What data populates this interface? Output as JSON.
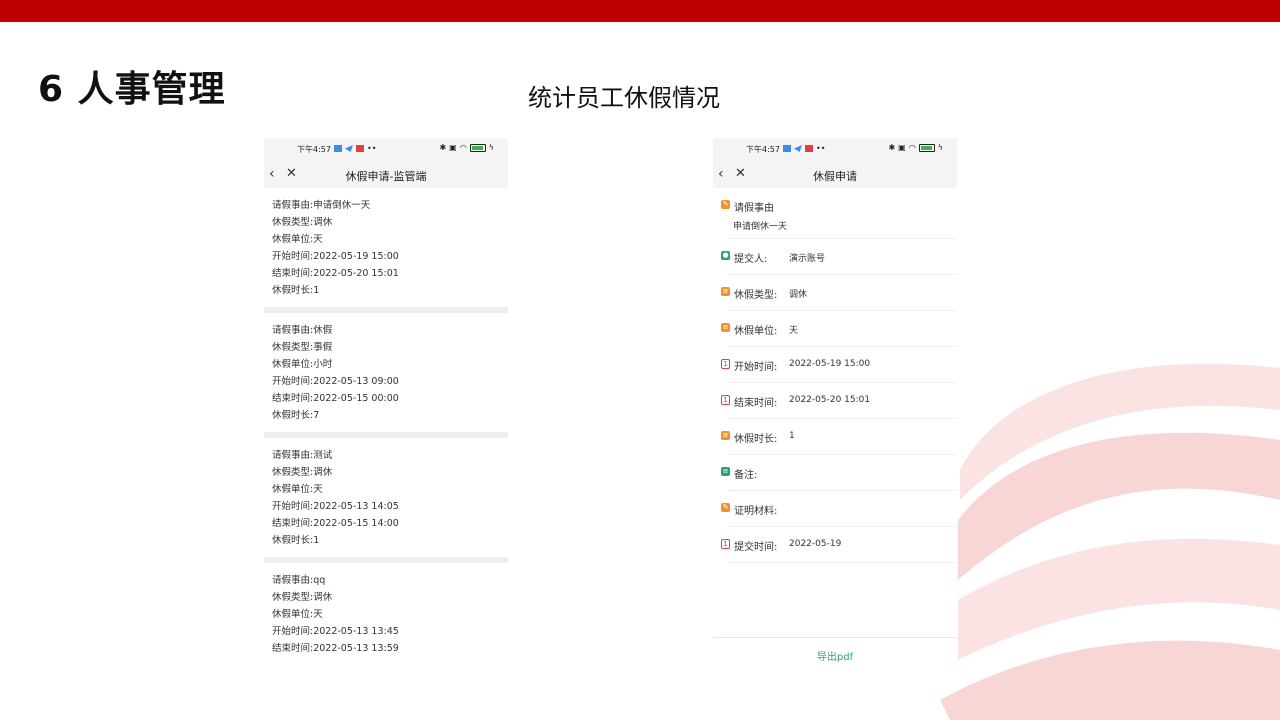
{
  "slide": {
    "title": "6 人事管理",
    "subtitle": "统计员工休假情况",
    "accent_color": "#c00000"
  },
  "status_bar": {
    "time": "下午4:57",
    "battery": "100"
  },
  "left_phone": {
    "nav_title": "休假申请-监管端",
    "records": [
      {
        "lines": [
          "请假事由:申请倒休一天",
          "休假类型:调休",
          "休假单位:天",
          "开始时间:2022-05-19 15:00",
          "结束时间:2022-05-20 15:01",
          "休假时长:1"
        ]
      },
      {
        "lines": [
          "请假事由:休假",
          "休假类型:事假",
          "休假单位:小时",
          "开始时间:2022-05-13 09:00",
          "结束时间:2022-05-15 00:00",
          "休假时长:7"
        ]
      },
      {
        "lines": [
          "请假事由:测试",
          "休假类型:调休",
          "休假单位:天",
          "开始时间:2022-05-13 14:05",
          "结束时间:2022-05-15 14:00",
          "休假时长:1"
        ]
      },
      {
        "lines": [
          "请假事由:qq",
          "休假类型:调休",
          "休假单位:天",
          "开始时间:2022-05-13 13:45",
          "结束时间:2022-05-13 13:59"
        ]
      }
    ]
  },
  "right_phone": {
    "nav_title": "休假申请",
    "reason_label": "请假事由",
    "reason_value": "申请倒休一天",
    "fields": [
      {
        "label": "提交人:",
        "value": "演示账号",
        "icon": "user-icon"
      },
      {
        "label": "休假类型:",
        "value": "调休",
        "icon": "list-icon"
      },
      {
        "label": "休假单位:",
        "value": "天",
        "icon": "list-icon"
      },
      {
        "label": "开始时间:",
        "value": "2022-05-19 15:00",
        "icon": "calendar-icon"
      },
      {
        "label": "结束时间:",
        "value": "2022-05-20 15:01",
        "icon": "calendar-icon"
      },
      {
        "label": "休假时长:",
        "value": "1",
        "icon": "list-icon"
      },
      {
        "label": "备注:",
        "value": "",
        "icon": "note-icon"
      },
      {
        "label": "证明材料:",
        "value": "",
        "icon": "edit-icon"
      },
      {
        "label": "提交时间:",
        "value": "2022-05-19",
        "icon": "calendar-icon"
      }
    ],
    "export_label": "导出pdf"
  }
}
